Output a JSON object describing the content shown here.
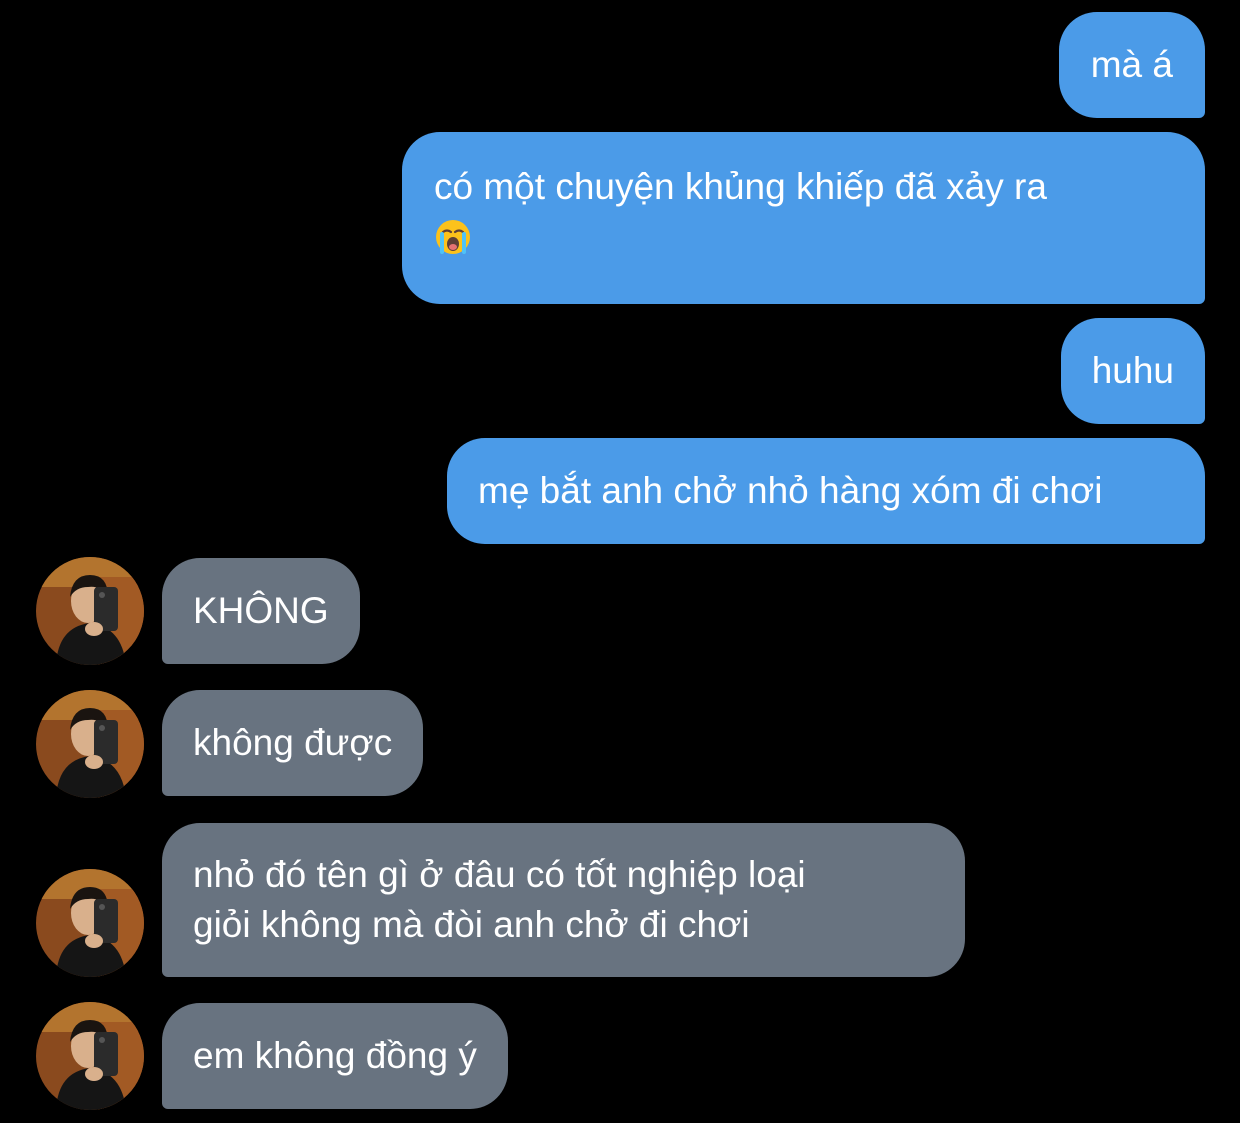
{
  "thread": {
    "messages": [
      {
        "sender": "me",
        "text": "mà á"
      },
      {
        "sender": "me",
        "text": "có một chuyện khủng khiếp đã xảy ra",
        "emoji": "loudly-crying-face-emoji"
      },
      {
        "sender": "me",
        "text": "huhu"
      },
      {
        "sender": "me",
        "text": "mẹ bắt anh chở nhỏ hàng xóm đi chơi"
      },
      {
        "sender": "them",
        "text": "KHÔNG"
      },
      {
        "sender": "them",
        "text": "không được"
      },
      {
        "sender": "them",
        "text": "nhỏ đó tên gì ở đâu có tốt nghiệp loại",
        "text_line2": "giỏi không mà đòi anh chở đi chơi"
      },
      {
        "sender": "them",
        "text": "em không đồng ý"
      }
    ]
  },
  "colors": {
    "background": "#000000",
    "sent_bubble": "#4b9be8",
    "received_bubble": "#687380",
    "text": "#ffffff"
  }
}
